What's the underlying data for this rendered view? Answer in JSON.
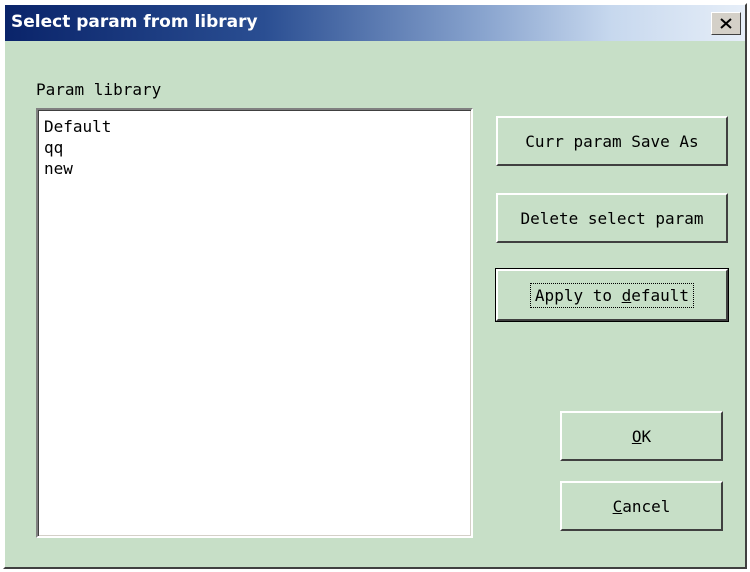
{
  "window": {
    "title": "Select param from library"
  },
  "param_library": {
    "label": "Param library",
    "items": [
      "Default",
      "qq",
      "new"
    ]
  },
  "buttons": {
    "save_as": "Curr param Save As",
    "delete": "Delete select param",
    "apply_default": {
      "before": "Apply to ",
      "mnemonic": "d",
      "after": "efault"
    },
    "ok": {
      "mnemonic": "O",
      "after": "K"
    },
    "cancel": {
      "mnemonic": "C",
      "after": "ancel"
    }
  },
  "icons": {
    "close": "close-icon"
  },
  "colors": {
    "dialog_bg": "#c7dfc7",
    "title_start": "#0a246a",
    "title_end": "#e6eef8"
  }
}
